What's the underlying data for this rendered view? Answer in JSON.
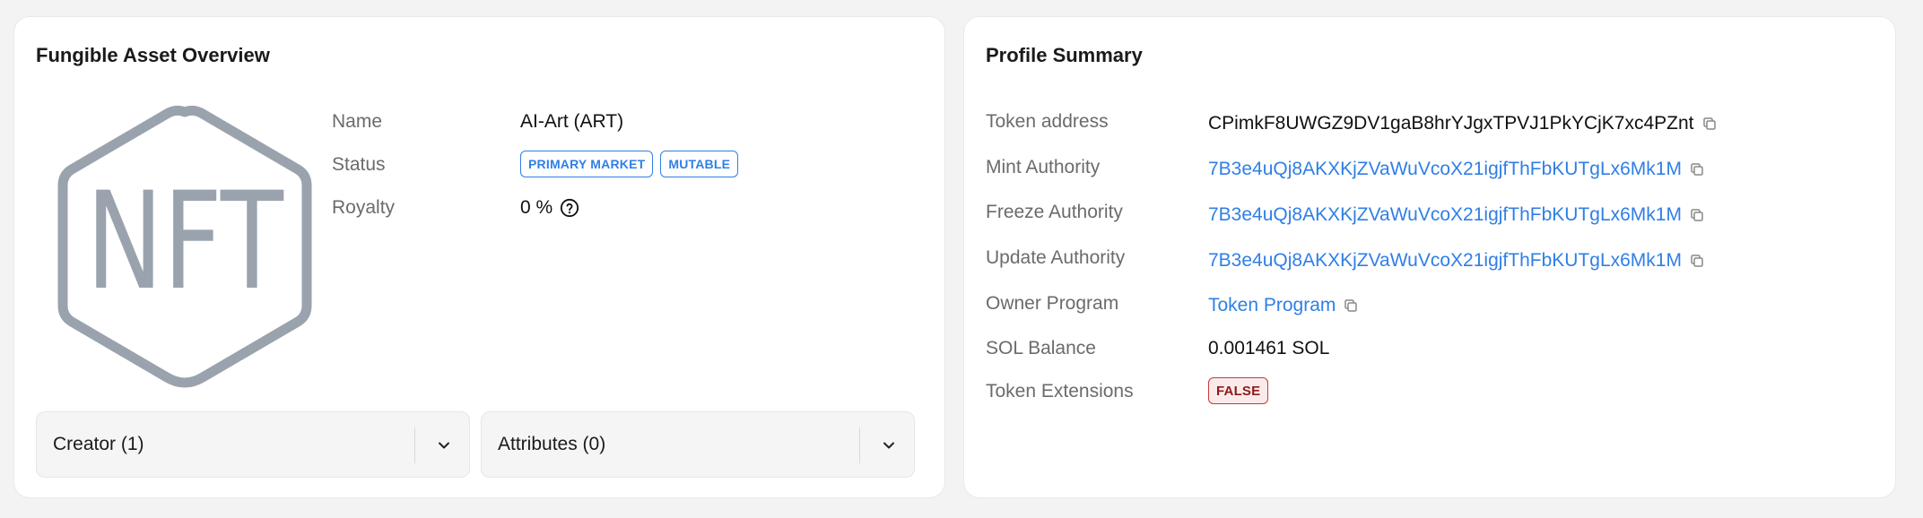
{
  "left_card": {
    "title": "Fungible Asset Overview",
    "logo_text": "NFT",
    "name_label": "Name",
    "name_value": "AI-Art (ART)",
    "status_label": "Status",
    "status_badges": [
      "PRIMARY MARKET",
      "MUTABLE"
    ],
    "royalty_label": "Royalty",
    "royalty_value": "0 %",
    "creator_label": "Creator (1)",
    "attributes_label": "Attributes (0)"
  },
  "right_card": {
    "title": "Profile Summary",
    "rows": [
      {
        "label": "Token address",
        "value": "CPimkF8UWGZ9DV1gaB8hrYJgxTPVJ1PkYCjK7xc4PZnt",
        "link": false,
        "copy": true
      },
      {
        "label": "Mint Authority",
        "value": "7B3e4uQj8AKXKjZVaWuVcoX21igjfThFbKUTgLx6Mk1M",
        "link": true,
        "copy": true
      },
      {
        "label": "Freeze Authority",
        "value": "7B3e4uQj8AKXKjZVaWuVcoX21igjfThFbKUTgLx6Mk1M",
        "link": true,
        "copy": true
      },
      {
        "label": "Update Authority",
        "value": "7B3e4uQj8AKXKjZVaWuVcoX21igjfThFbKUTgLx6Mk1M",
        "link": true,
        "copy": true
      },
      {
        "label": "Owner Program",
        "value": "Token Program",
        "link": true,
        "copy": true
      },
      {
        "label": "SOL Balance",
        "value": "0.001461 SOL",
        "link": false,
        "copy": false
      },
      {
        "label": "Token Extensions",
        "value": "FALSE",
        "link": false,
        "copy": false
      }
    ]
  },
  "colors": {
    "link": "#2f7fe6",
    "logo_gray": "#9aa3ad",
    "badge_false_text": "#8d1c1c",
    "badge_false_border": "#c43b3b"
  },
  "icons": [
    "copy-icon",
    "help-circle-icon",
    "chevron-down-icon"
  ]
}
